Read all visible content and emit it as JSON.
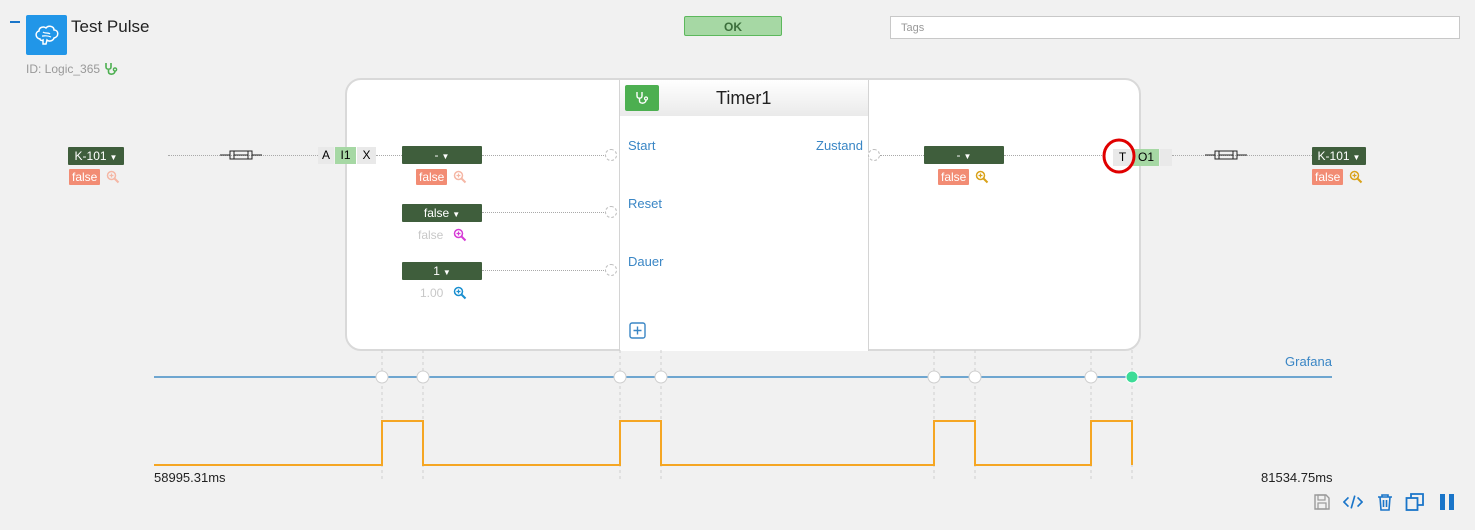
{
  "header": {
    "title": "Test Pulse",
    "id_label": "ID: Logic_365",
    "ok_label": "OK",
    "tags_placeholder": "Tags"
  },
  "node": {
    "title": "Timer1",
    "inputs": [
      {
        "label": "Start",
        "dropdown": "-",
        "value": "false"
      },
      {
        "label": "Reset",
        "dropdown": "false",
        "value": "false"
      },
      {
        "label": "Dauer",
        "dropdown": "1",
        "value": "1.00"
      }
    ],
    "outputs": [
      {
        "label": "Zustand",
        "dropdown": "-",
        "value": "false"
      }
    ]
  },
  "left_signal": {
    "tag": "K-101",
    "value": "false",
    "cells": [
      "A",
      "I1",
      "X"
    ]
  },
  "right_signal": {
    "tag": "K-101",
    "value": "false",
    "cells": [
      "T",
      "O1"
    ]
  },
  "timeline": {
    "label": "Grafana",
    "start": "58995.31ms",
    "end": "81534.75ms"
  },
  "colors": {
    "accent_blue": "#2196e8",
    "dropdown_green": "#3f5e3c",
    "false_badge": "#f28c74",
    "pulse": "#f5a623",
    "timeline": "#6ea6d0",
    "highlight": "#e00000"
  },
  "icons": [
    "brain-icon",
    "stethoscope-icon",
    "magnify-plus-icon",
    "fuse-icon",
    "add-icon",
    "save-icon",
    "code-icon",
    "trash-icon",
    "copy-icon",
    "pause-icon"
  ]
}
